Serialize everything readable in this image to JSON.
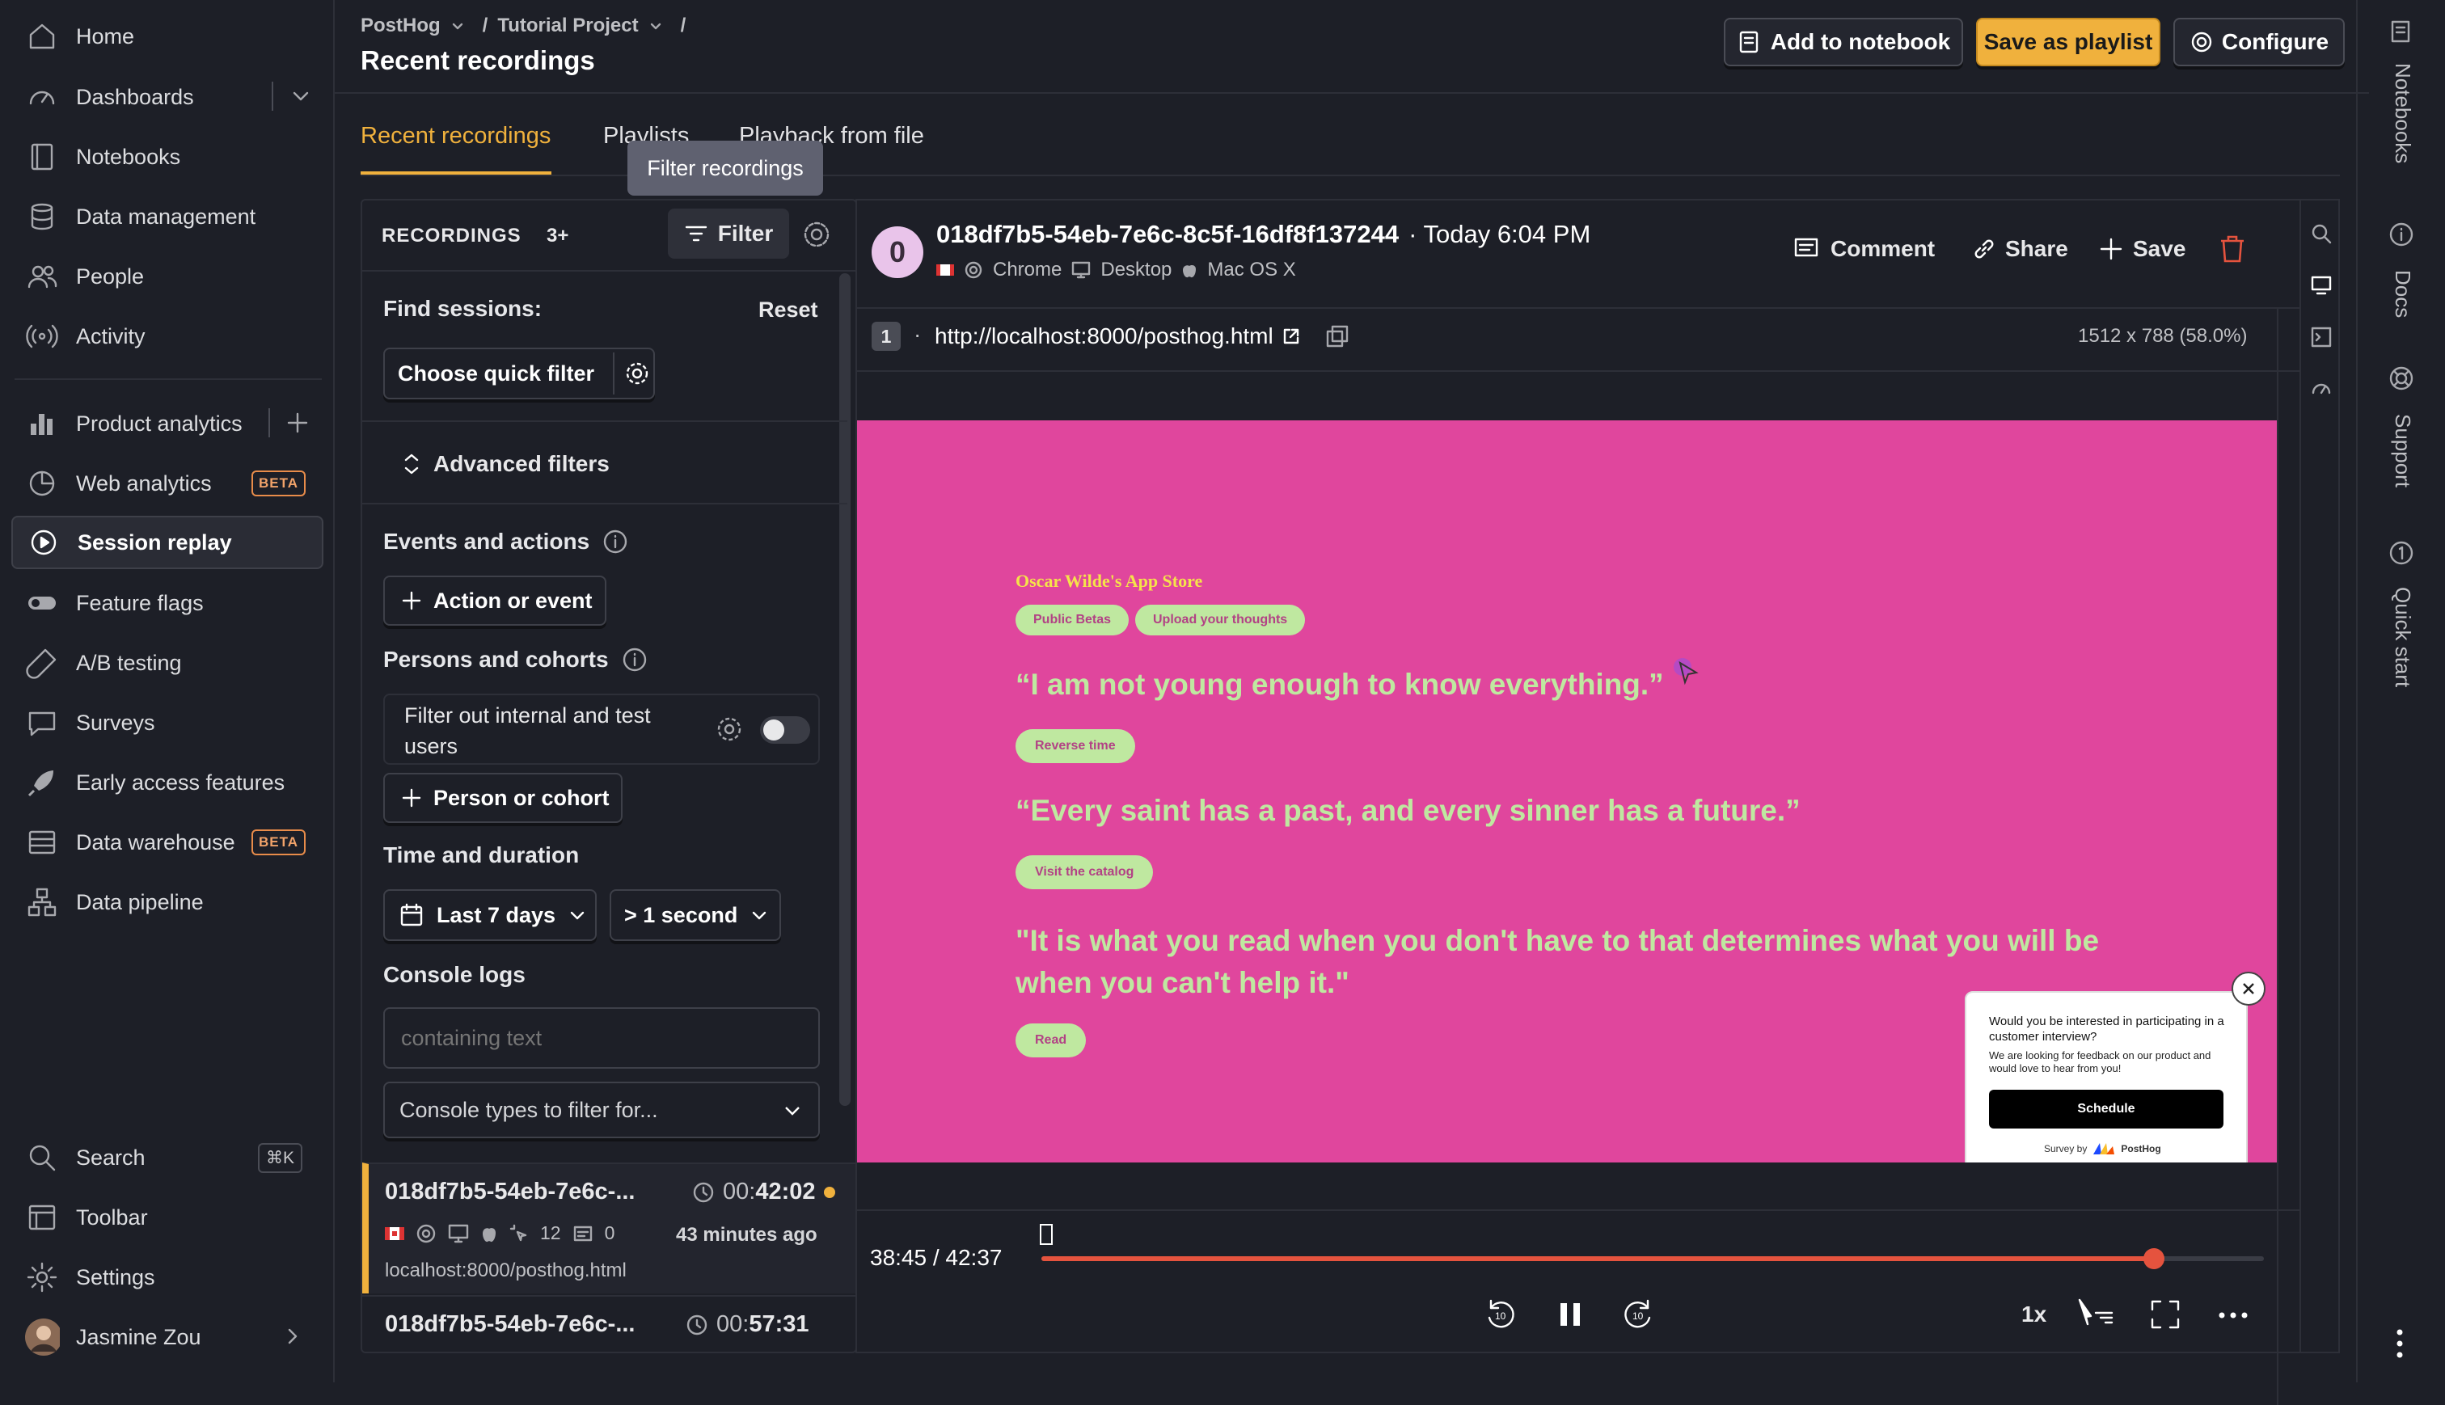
{
  "breadcrumb": {
    "org": "PostHog",
    "project": "Tutorial Project",
    "sep": "/"
  },
  "page_title": "Recent recordings",
  "header_buttons": {
    "notebook": "Add to notebook",
    "playlist": "Save as playlist",
    "configure": "Configure"
  },
  "nav": {
    "home": "Home",
    "dashboards": "Dashboards",
    "notebooks": "Notebooks",
    "data_management": "Data management",
    "people": "People",
    "activity": "Activity",
    "product_analytics": "Product analytics",
    "web_analytics": "Web analytics",
    "session_replay": "Session replay",
    "feature_flags": "Feature flags",
    "ab_testing": "A/B testing",
    "surveys": "Surveys",
    "early_access": "Early access features",
    "data_warehouse": "Data warehouse",
    "data_pipeline": "Data pipeline",
    "search": "Search",
    "search_kbd": "⌘K",
    "toolbar": "Toolbar",
    "settings": "Settings",
    "user": "Jasmine Zou",
    "beta": "BETA"
  },
  "tabs": {
    "recent": "Recent recordings",
    "playlists": "Playlists",
    "from_file": "Playback from file"
  },
  "tooltip": "Filter recordings",
  "panel": {
    "heading": "RECORDINGS",
    "count": "3+",
    "filter": "Filter",
    "find": "Find sessions:",
    "reset": "Reset",
    "quick": "Choose quick filter",
    "advanced": "Advanced filters",
    "events": "Events and actions",
    "action_btn": "Action or event",
    "persons": "Persons and cohorts",
    "internal": "Filter out internal and test users",
    "person_btn": "Person or cohort",
    "time": "Time and duration",
    "date": "Last 7 days",
    "duration": "> 1 second",
    "console": "Console logs",
    "console_ph": "containing text",
    "console_types": "Console types to filter for..."
  },
  "recordings": [
    {
      "id": "018df7b5-54eb-7e6c-...",
      "dur_prefix": "00:",
      "dur": "42:02",
      "count": "12",
      "comments": "0",
      "ago": "43 minutes ago",
      "url": "localhost:8000/posthog.html"
    },
    {
      "id": "018df7b5-54eb-7e6c-...",
      "dur_prefix": "00:",
      "dur": "57:31"
    }
  ],
  "session": {
    "avatar": "0",
    "id": "018df7b5-54eb-7e6c-8c5f-16df8f137244",
    "when": "· Today 6:04 PM",
    "browser": "Chrome",
    "device": "Desktop",
    "os": "Mac OS X",
    "comment": "Comment",
    "share": "Share",
    "save": "Save",
    "tab_num": "1",
    "url": "http://localhost:8000/posthog.html",
    "resolution": "1512 x 788 (58.0%)"
  },
  "site": {
    "store": "Oscar Wilde's App Store",
    "chip1": "Public Betas",
    "chip2": "Upload your thoughts",
    "q1": "“I am not young enough to know everything.”",
    "b1": "Reverse time",
    "q2": "“Every saint has a past, and every sinner has a future.”",
    "b2": "Visit the catalog",
    "q3": "\"It is what you read when you don't have to that determines what you will be when you can't help it.\"",
    "b3": "Read",
    "survey_q": "Would you be interested in participating in a customer interview?",
    "survey_d": "We are looking for feedback on our product and would love to hear from you!",
    "survey_btn": "Schedule",
    "survey_by": "Survey by",
    "survey_brand": "PostHog"
  },
  "playback": {
    "time": "38:45 / 42:37",
    "progress": 0.91,
    "speed": "1x"
  },
  "right_rail": {
    "notebooks": "Notebooks",
    "docs": "Docs",
    "support": "Support",
    "quickstart": "Quick start"
  },
  "colors": {
    "accent": "#f0b13d",
    "pink": "#e0469d",
    "danger": "#e5533e"
  }
}
